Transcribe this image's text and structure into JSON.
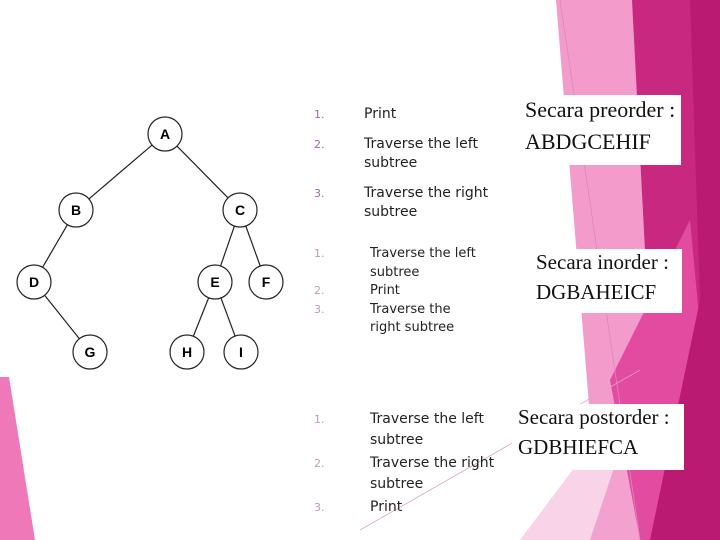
{
  "colors": {
    "pink_light": "#f5a8d2",
    "pink_mid": "#ee7fbd",
    "pink_strong": "#e34ba0",
    "magenta": "#c8287f",
    "magenta_dark": "#bb1a72",
    "pale_pink": "#f9d3e7"
  },
  "tree": {
    "nodes": [
      {
        "id": "A",
        "label": "A"
      },
      {
        "id": "B",
        "label": "B"
      },
      {
        "id": "C",
        "label": "C"
      },
      {
        "id": "D",
        "label": "D"
      },
      {
        "id": "E",
        "label": "E"
      },
      {
        "id": "F",
        "label": "F"
      },
      {
        "id": "G",
        "label": "G"
      },
      {
        "id": "H",
        "label": "H"
      },
      {
        "id": "I",
        "label": "I"
      }
    ],
    "edges": [
      [
        "A",
        "B"
      ],
      [
        "A",
        "C"
      ],
      [
        "B",
        "D"
      ],
      [
        "D",
        "G"
      ],
      [
        "C",
        "E"
      ],
      [
        "C",
        "F"
      ],
      [
        "E",
        "H"
      ],
      [
        "E",
        "I"
      ]
    ]
  },
  "preorder": {
    "steps": [
      {
        "num": "1.",
        "text": "Print"
      },
      {
        "num": "2.",
        "text": "Traverse the left subtree"
      },
      {
        "num": "3.",
        "text": "Traverse the right subtree"
      }
    ],
    "title": "Secara preorder :",
    "result": "ABDGCEHIF"
  },
  "inorder": {
    "steps": [
      {
        "num": "1.",
        "text": "Traverse the left subtree"
      },
      {
        "num": "2.",
        "text": "Print"
      },
      {
        "num": "3.",
        "text": "Traverse the right subtree"
      }
    ],
    "title": "Secara inorder :",
    "result": "DGBAHEICF"
  },
  "postorder": {
    "steps": [
      {
        "num": "1.",
        "text": "Traverse the left subtree"
      },
      {
        "num": "2.",
        "text": "Traverse the right subtree"
      },
      {
        "num": "3.",
        "text": "Print"
      }
    ],
    "title": "Secara postorder :",
    "result": "GDBHIEFCA"
  }
}
